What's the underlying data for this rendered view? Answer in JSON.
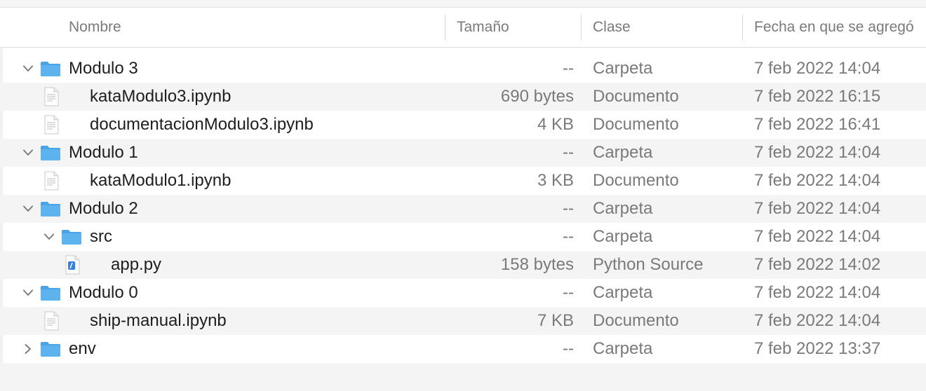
{
  "columns": {
    "name": "Nombre",
    "size": "Tamaño",
    "kind": "Clase",
    "date": "Fecha en que se agregó"
  },
  "rows": [
    {
      "name": "Modulo 3",
      "level": 0,
      "type": "folder",
      "expanded": true,
      "size": "--",
      "kind": "Carpeta",
      "date": "7 feb 2022 14:04"
    },
    {
      "name": "kataModulo3.ipynb",
      "level": 1,
      "type": "document",
      "size": "690 bytes",
      "kind": "Documento",
      "date": "7 feb 2022 16:15"
    },
    {
      "name": "documentacionModulo3.ipynb",
      "level": 1,
      "type": "document",
      "size": "4 KB",
      "kind": "Documento",
      "date": "7 feb 2022 16:41"
    },
    {
      "name": "Modulo 1",
      "level": 0,
      "type": "folder",
      "expanded": true,
      "size": "--",
      "kind": "Carpeta",
      "date": "7 feb 2022 14:04"
    },
    {
      "name": "kataModulo1.ipynb",
      "level": 1,
      "type": "document",
      "size": "3 KB",
      "kind": "Documento",
      "date": "7 feb 2022 14:04"
    },
    {
      "name": "Modulo 2",
      "level": 0,
      "type": "folder",
      "expanded": true,
      "size": "--",
      "kind": "Carpeta",
      "date": "7 feb 2022 14:04"
    },
    {
      "name": "src",
      "level": 1,
      "type": "folder",
      "expanded": true,
      "size": "--",
      "kind": "Carpeta",
      "date": "7 feb 2022 14:04"
    },
    {
      "name": "app.py",
      "level": 2,
      "type": "python",
      "size": "158 bytes",
      "kind": "Python Source",
      "date": "7 feb 2022 14:02"
    },
    {
      "name": "Modulo 0",
      "level": 0,
      "type": "folder",
      "expanded": true,
      "size": "--",
      "kind": "Carpeta",
      "date": "7 feb 2022 14:04"
    },
    {
      "name": "ship-manual.ipynb",
      "level": 1,
      "type": "document",
      "size": "7 KB",
      "kind": "Documento",
      "date": "7 feb 2022 14:04"
    },
    {
      "name": "env",
      "level": 0,
      "type": "folder",
      "expanded": false,
      "size": "--",
      "kind": "Carpeta",
      "date": "7 feb 2022 13:37"
    }
  ],
  "colors": {
    "folder": "#5db3ee",
    "folder_tab": "#4aa3e3",
    "alt_row": "#f4f4f4",
    "secondary_text": "#7a7a7a",
    "python_badge": "#2f7ff0"
  }
}
